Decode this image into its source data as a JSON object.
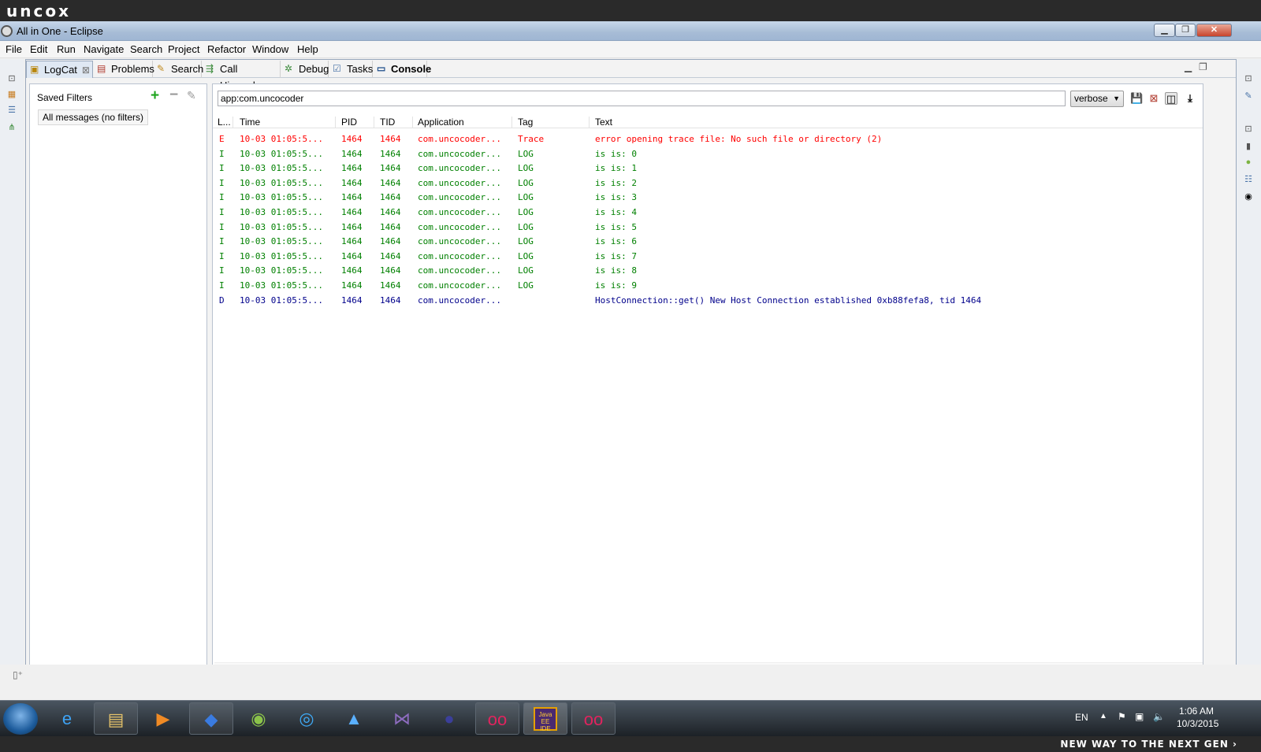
{
  "brand": {
    "logo": "uncox",
    "tagline": "NEW WAY TO THE NEXT GEN ›"
  },
  "window": {
    "title": "All in One - Eclipse",
    "buttons": [
      "▁",
      "❐",
      "✕"
    ]
  },
  "menu": [
    "File",
    "Edit",
    "Run",
    "Navigate",
    "Search",
    "Project",
    "Refactor",
    "Window",
    "Help"
  ],
  "tabs": [
    {
      "label": "LogCat",
      "icon": "logcat-icon",
      "active": true
    },
    {
      "label": "Problems",
      "icon": "problems-icon"
    },
    {
      "label": "Search",
      "icon": "search-icon"
    },
    {
      "label": "Call Hierarchy",
      "icon": "call-hierarchy-icon"
    },
    {
      "label": "Debug",
      "icon": "debug-icon"
    },
    {
      "label": "Tasks",
      "icon": "tasks-icon"
    },
    {
      "label": "Console",
      "icon": "console-icon"
    }
  ],
  "filters": {
    "header": "Saved Filters",
    "items": [
      "All messages (no filters)"
    ]
  },
  "logcat": {
    "search_value": "app:com.uncocoder",
    "level_selected": "verbose",
    "columns": [
      "L...",
      "Time",
      "PID",
      "TID",
      "Application",
      "Tag",
      "Text"
    ],
    "colors": {
      "E": "#ff0000",
      "I": "#008000",
      "D": "#00008b"
    },
    "rows": [
      {
        "level": "E",
        "time": "10-03 01:05:5...",
        "pid": "1464",
        "tid": "1464",
        "app": "com.uncocoder...",
        "tag": "Trace",
        "text": "error opening trace file: No such file or directory (2)"
      },
      {
        "level": "I",
        "time": "10-03 01:05:5...",
        "pid": "1464",
        "tid": "1464",
        "app": "com.uncocoder...",
        "tag": "LOG",
        "text": "is is: 0"
      },
      {
        "level": "I",
        "time": "10-03 01:05:5...",
        "pid": "1464",
        "tid": "1464",
        "app": "com.uncocoder...",
        "tag": "LOG",
        "text": "is is: 1"
      },
      {
        "level": "I",
        "time": "10-03 01:05:5...",
        "pid": "1464",
        "tid": "1464",
        "app": "com.uncocoder...",
        "tag": "LOG",
        "text": "is is: 2"
      },
      {
        "level": "I",
        "time": "10-03 01:05:5...",
        "pid": "1464",
        "tid": "1464",
        "app": "com.uncocoder...",
        "tag": "LOG",
        "text": "is is: 3"
      },
      {
        "level": "I",
        "time": "10-03 01:05:5...",
        "pid": "1464",
        "tid": "1464",
        "app": "com.uncocoder...",
        "tag": "LOG",
        "text": "is is: 4"
      },
      {
        "level": "I",
        "time": "10-03 01:05:5...",
        "pid": "1464",
        "tid": "1464",
        "app": "com.uncocoder...",
        "tag": "LOG",
        "text": "is is: 5"
      },
      {
        "level": "I",
        "time": "10-03 01:05:5...",
        "pid": "1464",
        "tid": "1464",
        "app": "com.uncocoder...",
        "tag": "LOG",
        "text": "is is: 6"
      },
      {
        "level": "I",
        "time": "10-03 01:05:5...",
        "pid": "1464",
        "tid": "1464",
        "app": "com.uncocoder...",
        "tag": "LOG",
        "text": "is is: 7"
      },
      {
        "level": "I",
        "time": "10-03 01:05:5...",
        "pid": "1464",
        "tid": "1464",
        "app": "com.uncocoder...",
        "tag": "LOG",
        "text": "is is: 8"
      },
      {
        "level": "I",
        "time": "10-03 01:05:5...",
        "pid": "1464",
        "tid": "1464",
        "app": "com.uncocoder...",
        "tag": "LOG",
        "text": "is is: 9"
      },
      {
        "level": "D",
        "time": "10-03 01:05:5...",
        "pid": "1464",
        "tid": "1464",
        "app": "com.uncocoder...",
        "tag": "",
        "text": "HostConnection::get() New Host Connection established 0xb88fefa8, tid 1464"
      }
    ]
  },
  "taskbar": {
    "apps": [
      "internet-explorer-icon",
      "file-explorer-icon",
      "media-player-icon",
      "app-icon",
      "app-icon",
      "app-icon",
      "app-icon",
      "visual-studio-icon",
      "eclipse-icon",
      "app-icon",
      "java-ee-ide-icon",
      "app-icon"
    ],
    "java_ee_label": "Java EE IDE",
    "lang": "EN",
    "time": "1:06 AM",
    "date": "10/3/2015"
  }
}
